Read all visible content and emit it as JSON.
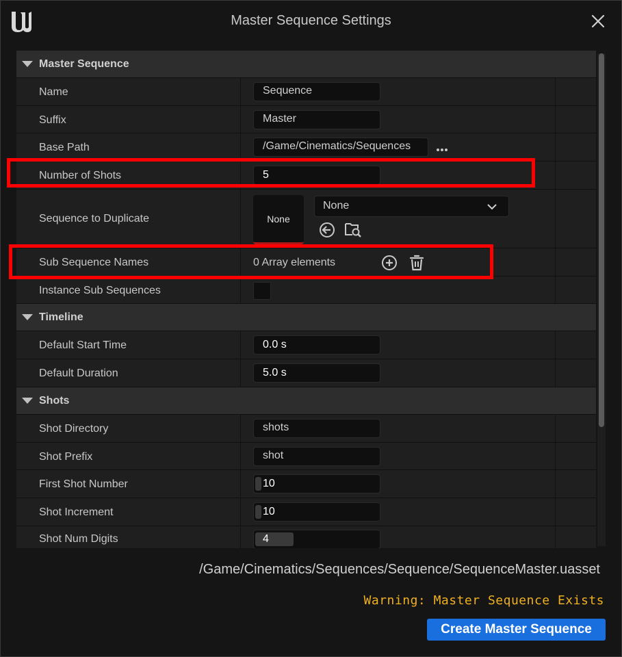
{
  "window": {
    "title": "Master Sequence Settings",
    "logo_icon": "unreal-logo-icon",
    "close_icon": "close-icon"
  },
  "categories": {
    "master": "Master Sequence",
    "timeline": "Timeline",
    "shots": "Shots"
  },
  "props": {
    "name": {
      "label": "Name",
      "value": "Sequence"
    },
    "suffix": {
      "label": "Suffix",
      "value": "Master"
    },
    "base_path": {
      "label": "Base Path",
      "value": "/Game/Cinematics/Sequences"
    },
    "num_shots": {
      "label": "Number of Shots",
      "value": "5"
    },
    "dup": {
      "label": "Sequence to Duplicate",
      "thumb": "None",
      "combo": "None"
    },
    "sub_names": {
      "label": "Sub Sequence Names",
      "value": "0 Array elements"
    },
    "instance": {
      "label": "Instance Sub Sequences",
      "checked": false
    },
    "start": {
      "label": "Default Start Time",
      "value": "0.0 s"
    },
    "duration": {
      "label": "Default Duration",
      "value": "5.0 s"
    },
    "shot_dir": {
      "label": "Shot Directory",
      "value": "shots"
    },
    "shot_prefix": {
      "label": "Shot Prefix",
      "value": "shot"
    },
    "first_shot": {
      "label": "First Shot Number",
      "value": "10"
    },
    "increment": {
      "label": "Shot Increment",
      "value": "10"
    },
    "digits": {
      "label": "Shot Num Digits",
      "value": "4"
    }
  },
  "footer": {
    "asset_path": "/Game/Cinematics/Sequences/Sequence/SequenceMaster.uasset",
    "warning": "Warning: Master Sequence Exists",
    "create_label": "Create Master Sequence"
  },
  "colors": {
    "highlight": "#ff0000",
    "warning": "#f0b020",
    "primary_button": "#1a6fde"
  }
}
